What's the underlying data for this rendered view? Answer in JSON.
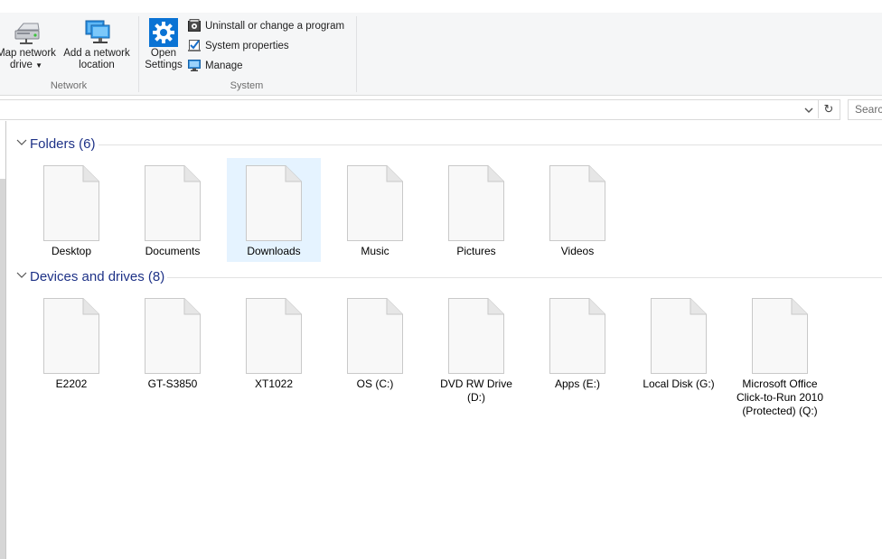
{
  "ribbon": {
    "network_group": {
      "label": "Network",
      "map_network_drive": "Map network drive",
      "add_network_location": "Add a network location"
    },
    "system_group": {
      "label": "System",
      "open_settings": "Open Settings",
      "uninstall": "Uninstall or change a program",
      "system_properties": "System properties",
      "manage": "Manage"
    }
  },
  "address_bar": {
    "search_placeholder": "Search"
  },
  "groups": {
    "folders": {
      "title": "Folders (6)",
      "items": [
        "Desktop",
        "Documents",
        "Downloads",
        "Music",
        "Pictures",
        "Videos"
      ],
      "selected": "Downloads"
    },
    "drives": {
      "title": "Devices and drives (8)",
      "items": [
        "E2202",
        "GT-S3850",
        "XT1022",
        "OS (C:)",
        "DVD RW Drive (D:)",
        "Apps (E:)",
        "Local Disk (G:)",
        "Microsoft Office Click-to-Run 2010 (Protected) (Q:)"
      ]
    }
  },
  "colors": {
    "accent": "#1e3287",
    "selection": "#e5f3ff",
    "ribbon_bg": "#f5f6f7",
    "settings_blue": "#0a73d4"
  }
}
